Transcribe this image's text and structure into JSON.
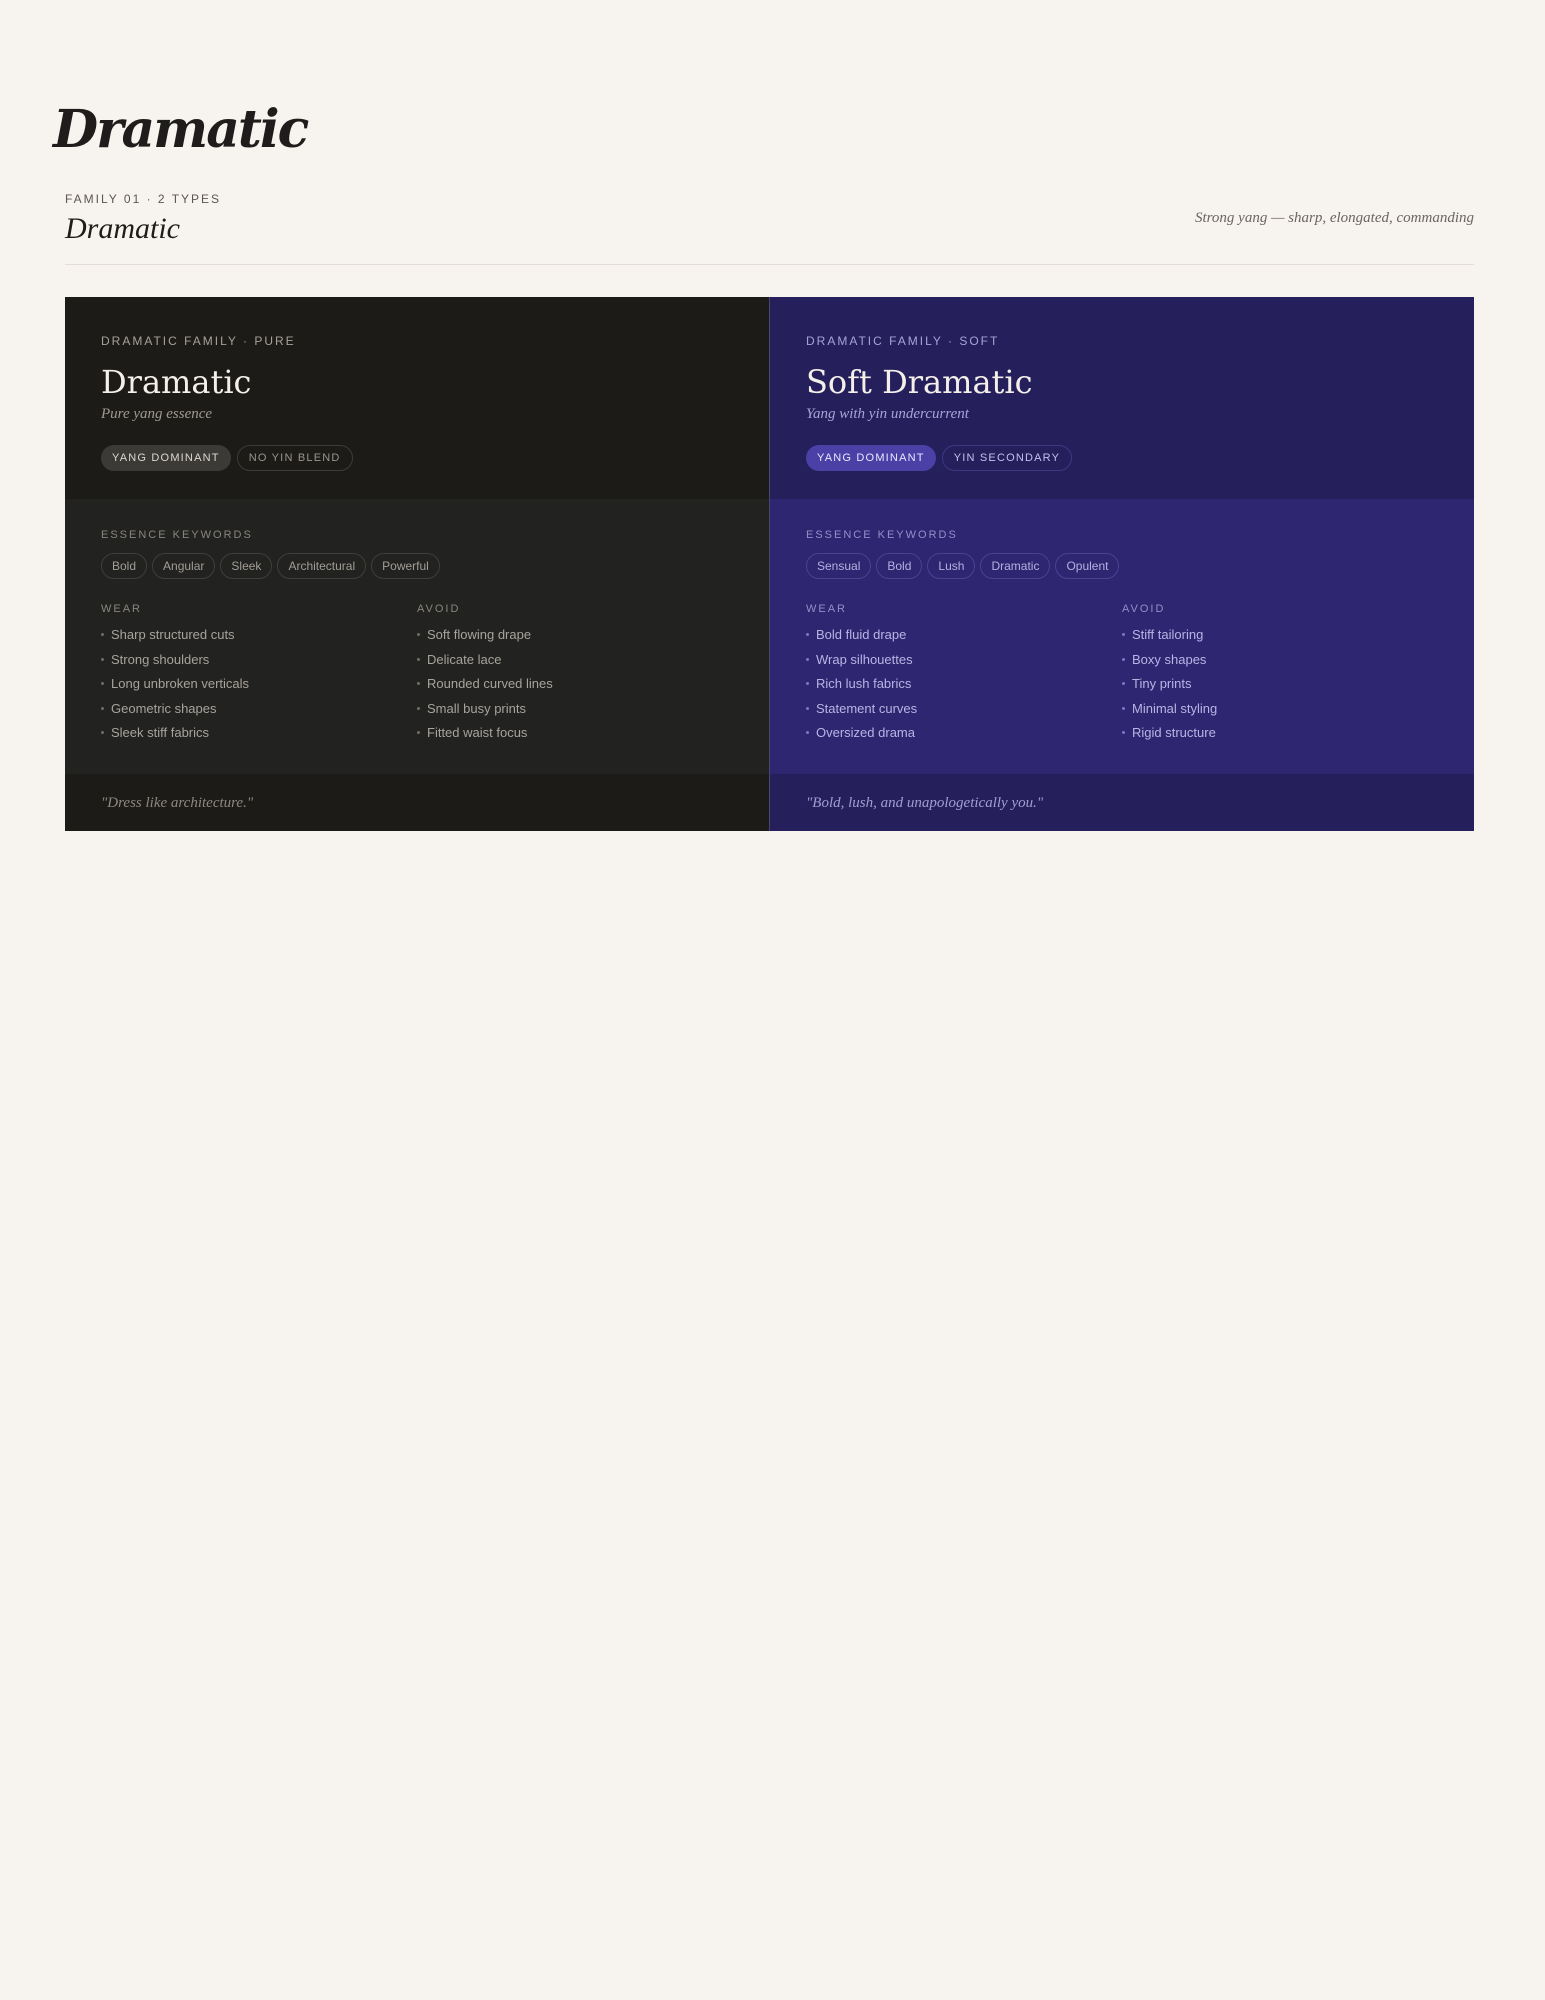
{
  "page": {
    "title": "Dramatic"
  },
  "family": {
    "meta": "FAMILY 01 · 2 TYPES",
    "name": "Dramatic",
    "tagline": "Strong yang — sharp, elongated, commanding"
  },
  "cards": [
    {
      "eyebrow": "DRAMATIC FAMILY · PURE",
      "name": "Dramatic",
      "subtitle": "Pure yang essence",
      "pills": [
        {
          "label": "YANG DOMINANT",
          "style": "filled"
        },
        {
          "label": "NO YIN BLEND",
          "style": "outline"
        }
      ],
      "keywords_label": "ESSENCE KEYWORDS",
      "keywords": [
        "Bold",
        "Angular",
        "Sleek",
        "Architectural",
        "Powerful"
      ],
      "wear_label": "WEAR",
      "wear": [
        "Sharp structured cuts",
        "Strong shoulders",
        "Long unbroken verticals",
        "Geometric shapes",
        "Sleek stiff fabrics"
      ],
      "avoid_label": "AVOID",
      "avoid": [
        "Soft flowing drape",
        "Delicate lace",
        "Rounded curved lines",
        "Small busy prints",
        "Fitted waist focus"
      ],
      "quote": "\"Dress like architecture.\""
    },
    {
      "eyebrow": "DRAMATIC FAMILY · SOFT",
      "name": "Soft Dramatic",
      "subtitle": "Yang with yin undercurrent",
      "pills": [
        {
          "label": "YANG DOMINANT",
          "style": "filled"
        },
        {
          "label": "YIN SECONDARY",
          "style": "outline"
        }
      ],
      "keywords_label": "ESSENCE KEYWORDS",
      "keywords": [
        "Sensual",
        "Bold",
        "Lush",
        "Dramatic",
        "Opulent"
      ],
      "wear_label": "WEAR",
      "wear": [
        "Bold fluid drape",
        "Wrap silhouettes",
        "Rich lush fabrics",
        "Statement curves",
        "Oversized drama"
      ],
      "avoid_label": "AVOID",
      "avoid": [
        "Stiff tailoring",
        "Boxy shapes",
        "Tiny prints",
        "Minimal styling",
        "Rigid structure"
      ],
      "quote": "\"Bold, lush, and unapologetically you.\""
    }
  ]
}
